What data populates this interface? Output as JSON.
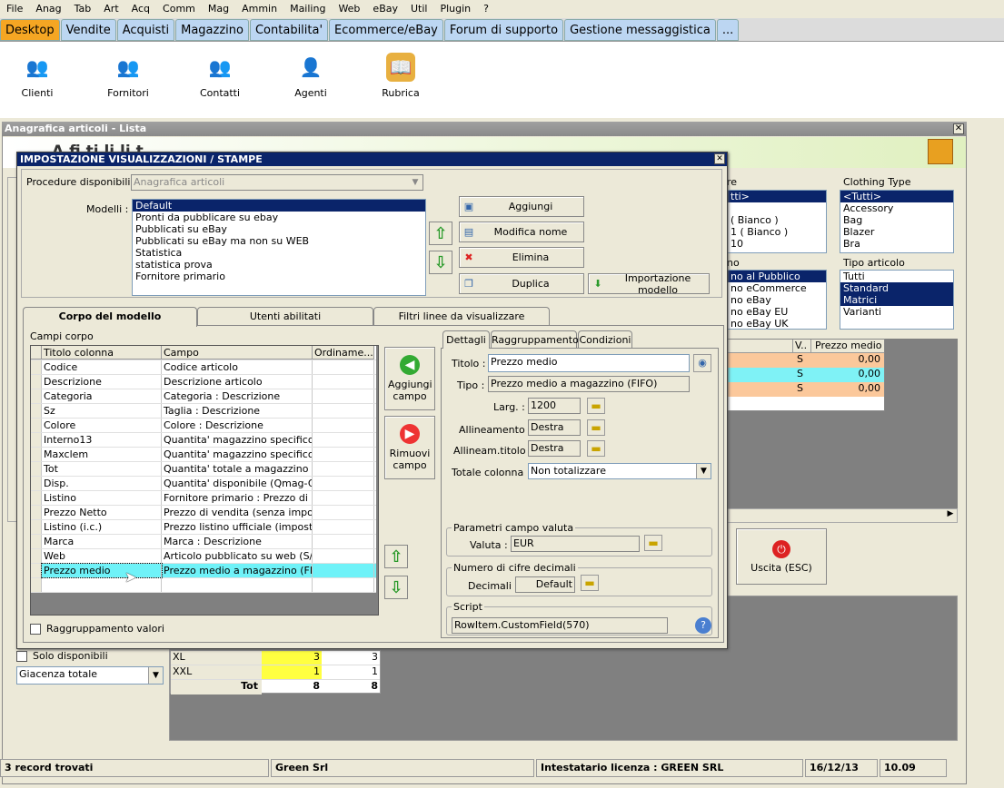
{
  "menu": [
    "File",
    "Anag",
    "Tab",
    "Art",
    "Acq",
    "Comm",
    "Mag",
    "Ammin",
    "Mailing",
    "Web",
    "eBay",
    "Util",
    "Plugin",
    "?"
  ],
  "main_tabs": [
    "Desktop",
    "Vendite",
    "Acquisti",
    "Magazzino",
    "Contabilita'",
    "Ecommerce/eBay",
    "Forum di supporto",
    "Gestione messaggistica",
    "..."
  ],
  "desktop_icons": [
    "Clienti",
    "Fornitori",
    "Contatti",
    "Agenti",
    "Rubrica"
  ],
  "bg_window": {
    "title": "Anagrafica articoli  - Lista",
    "partial_heading": "A     fi    ti  li  li   t",
    "list1_title": "re",
    "list1": [
      "tti>",
      "",
      "( Bianco )",
      "1 ( Bianco )",
      "10"
    ],
    "list2_title": "Clothing Type",
    "list2": [
      "<Tutti>",
      "Accessory",
      "Bag",
      "Blazer",
      "Bra"
    ],
    "list3_title": "no",
    "list3": [
      "no al Pubblico",
      "no eCommerce",
      "no eBay",
      "no eBay EU",
      "no eBay UK"
    ],
    "list4_title": "Tipo articolo",
    "list4": [
      "Tutti",
      "Standard",
      "Matrici",
      "Varianti"
    ],
    "grid_headers": [
      "V..",
      "Prezzo medio"
    ],
    "grid_rows": [
      {
        "v": "S",
        "p": "0,00"
      },
      {
        "v": "S",
        "p": "0,00"
      },
      {
        "v": "S",
        "p": "0,00"
      }
    ],
    "exit_label": "Uscita (ESC)",
    "solo_disp": "Solo disponibili",
    "giacenza": "Giacenza totale",
    "size_rows": [
      {
        "s": "XL",
        "a": "3",
        "b": "3"
      },
      {
        "s": "XXL",
        "a": "1",
        "b": "1"
      }
    ],
    "tot_label": "Tot",
    "tot_a": "8",
    "tot_b": "8"
  },
  "dialog": {
    "title": "IMPOSTAZIONE VISUALIZZAZIONI / STAMPE",
    "procedure_label": "Procedure disponibili :",
    "procedure_value": "Anagrafica articoli",
    "modelli_label": "Modelli :",
    "modelli": [
      "Default",
      "Pronti da pubblicare su ebay",
      "Pubblicati su eBay",
      "Pubblicati su eBay ma non su WEB",
      "Statistica",
      "statistica prova",
      "Fornitore primario"
    ],
    "btn_aggiungi": "Aggiungi",
    "btn_modifica": "Modifica nome",
    "btn_elimina": "Elimina",
    "btn_duplica": "Duplica",
    "btn_import": "Importazione modello",
    "tabs": [
      "Corpo del modello",
      "Utenti abilitati",
      "Filtri linee da visualizzare"
    ],
    "campi_corpo": "Campi corpo",
    "cols": [
      "Titolo colonna",
      "Campo",
      "Ordiname..."
    ],
    "rows": [
      [
        "Codice",
        "Codice articolo"
      ],
      [
        "Descrizione",
        "Descrizione articolo"
      ],
      [
        "Categoria",
        "Categoria : Descrizione"
      ],
      [
        "Sz",
        "Taglia : Descrizione"
      ],
      [
        "Colore",
        "Colore : Descrizione"
      ],
      [
        "Interno13",
        "Quantita' magazzino specifico"
      ],
      [
        "Maxclem",
        "Quantita' magazzino specifico"
      ],
      [
        "Tot",
        "Quantita' totale a magazzino"
      ],
      [
        "Disp.",
        "Quantita' disponibile (Qmag-Qo..."
      ],
      [
        "Listino",
        "Fornitore primario : Prezzo di li..."
      ],
      [
        "Prezzo Netto",
        "Prezzo di vendita (senza imposte)"
      ],
      [
        "Listino (i.c.)",
        "Prezzo listino ufficiale (imposte ..."
      ],
      [
        "Marca",
        "Marca : Descrizione"
      ],
      [
        "Web",
        "Articolo pubblicato su web (S/N)"
      ],
      [
        "Prezzo medio",
        "Prezzo medio a magazzino (FIFO)"
      ]
    ],
    "add_field": "Aggiungi campo",
    "remove_field": "Rimuovi campo",
    "raggr_valori": "Raggruppamento valori",
    "subtabs": [
      "Dettagli",
      "Raggruppamento",
      "Condizioni"
    ],
    "titolo_label": "Titolo :",
    "titolo_value": "Prezzo medio",
    "tipo_label": "Tipo :",
    "tipo_value": "Prezzo medio a magazzino (FIFO)",
    "larg_label": "Larg. :",
    "larg_value": "1200",
    "allin_label": "Allineamento :",
    "allin_value": "Destra",
    "allin_t_label": "Allineam.titolo :",
    "allin_t_value": "Destra",
    "totale_label": "Totale colonna :",
    "totale_value": "Non totalizzare",
    "valuta_group": "Parametri campo valuta",
    "valuta_label": "Valuta :",
    "valuta_value": "EUR",
    "decimali_group": "Numero di cifre decimali",
    "decimali_label": "Decimali :",
    "decimali_value": "Default",
    "script_group": "Script",
    "script_value": "RowItem.CustomField(570)"
  },
  "status": {
    "records": "3 record trovati",
    "company": "Green Srl",
    "license": "Intestatario licenza : GREEN SRL",
    "date": "16/12/13",
    "time": "10.09"
  }
}
